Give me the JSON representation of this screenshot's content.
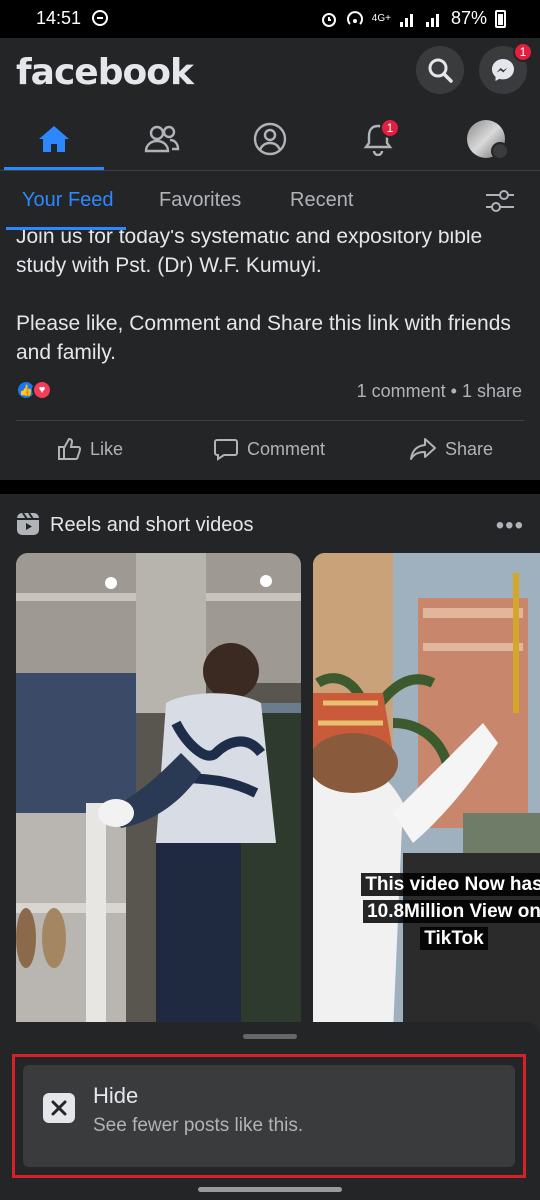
{
  "status_bar": {
    "time": "14:51",
    "network": "4G+",
    "battery": "87%"
  },
  "header": {
    "logo": "facebook",
    "search_icon": "search-icon",
    "messenger_icon": "messenger-icon",
    "messenger_badge": "1"
  },
  "nav": {
    "items": [
      {
        "name": "home-icon",
        "active": true
      },
      {
        "name": "friends-icon",
        "active": false
      },
      {
        "name": "profile-icon",
        "active": false
      },
      {
        "name": "notifications-icon",
        "active": false,
        "badge": "1"
      },
      {
        "name": "menu-avatar",
        "active": false
      }
    ]
  },
  "feed_tabs": {
    "tabs": [
      "Your Feed",
      "Favorites",
      "Recent"
    ],
    "active": "Your Feed",
    "filter_icon": "filter-sliders-icon"
  },
  "post": {
    "text": "Join us for today's systematic and expository bible study with Pst. (Dr) W.F. Kumuyi.\n\nPlease like, Comment and Share this link with friends and family.",
    "stats": "1 comment • 1 share",
    "actions": [
      "Like",
      "Comment",
      "Share"
    ]
  },
  "reels": {
    "title": "Reels and short videos",
    "more": "•••",
    "caption": "This video Now has 10.8Million View on TikTok"
  },
  "sheet": {
    "option_title": "Hide",
    "option_subtitle": "See fewer posts like this."
  },
  "colors": {
    "accent": "#2d88ff",
    "badge": "#e41e3f",
    "highlight": "#d72129",
    "surface": "#242526"
  }
}
